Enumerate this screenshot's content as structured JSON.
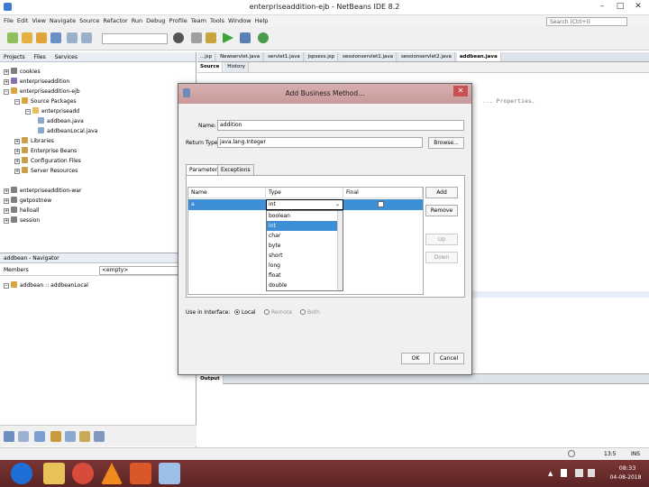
{
  "window": {
    "title": "enterpriseaddition-ejb - NetBeans IDE 8.2"
  },
  "menu": [
    "File",
    "Edit",
    "View",
    "Navigate",
    "Source",
    "Refactor",
    "Run",
    "Debug",
    "Profile",
    "Team",
    "Tools",
    "Window",
    "Help"
  ],
  "search_placeholder": "Search (Ctrl+I)",
  "projects_panel": {
    "tabs": [
      "Projects",
      "Files",
      "Services"
    ],
    "tree": [
      "cookies",
      "enterpriseaddition",
      "enterpriseaddition-ejb",
      "Source Packages",
      "enterpriseadd",
      "addbean.java",
      "addbeanLocal.java",
      "Libraries",
      "Enterprise Beans",
      "Configuration Files",
      "Server Resources",
      "enterpriseaddition-war",
      "getpostnew",
      "helloall",
      "session"
    ]
  },
  "navigator_panel": {
    "tabs": [
      "addbean - Navigator"
    ],
    "members_label": "Members",
    "filter_value": "<empty>",
    "item": "addbean :: addbeanLocal"
  },
  "editor": {
    "tabs": [
      "...jsp",
      "Newservlet.java",
      "servlet1.java",
      "jspsess.jsp",
      "sessionservlet1.java",
      "sessionservlet2.java",
      "addbean.java"
    ],
    "subtabs": [
      "Source",
      "History"
    ],
    "visible_code": "... Properties."
  },
  "output_panel": {
    "tab": "Output"
  },
  "dialog": {
    "title": "Add Business Method...",
    "name_label": "Name:",
    "name_value": "addition",
    "return_label": "Return Type:",
    "return_value": "java.lang.Integer",
    "browse_label": "Browse...",
    "tabs": [
      "Parameters",
      "Exceptions"
    ],
    "columns": [
      "Name",
      "Type",
      "Final"
    ],
    "row": {
      "name": "a",
      "type": "int"
    },
    "type_options": [
      "boolean",
      "int",
      "char",
      "byte",
      "short",
      "long",
      "float",
      "double"
    ],
    "selected_option": "int",
    "side_buttons": [
      "Add",
      "Remove",
      "Up",
      "Down"
    ],
    "use_in_interface_label": "Use in Interface:",
    "interface_options": [
      "Local",
      "Remote",
      "Both"
    ],
    "interface_selected": "Local",
    "ok_label": "OK",
    "cancel_label": "Cancel"
  },
  "statusbar": {
    "position": "13:5",
    "mode": "INS"
  },
  "taskbar": {
    "time": "08:33",
    "date": "04-08-2018"
  }
}
